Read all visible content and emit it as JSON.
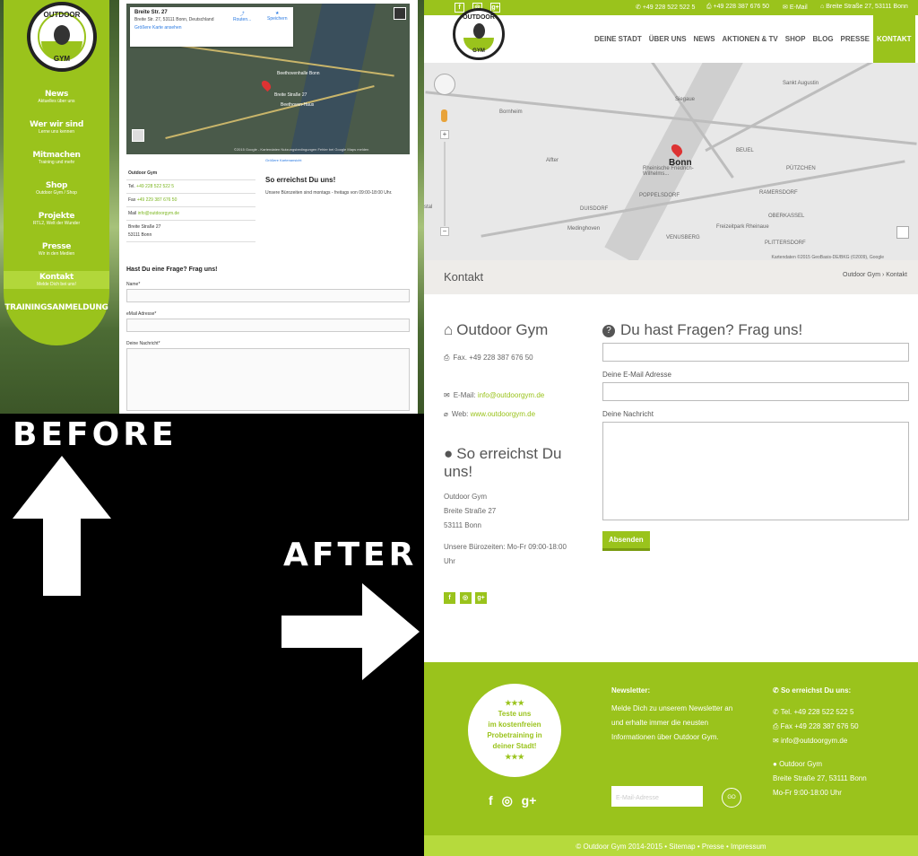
{
  "labels": {
    "before": "BEFORE",
    "after": "AFTER"
  },
  "before": {
    "logo": {
      "top": "OUTDOOR",
      "bottom": "GYM"
    },
    "nav": [
      {
        "main": "News",
        "sub": "Aktuelles über uns"
      },
      {
        "main": "Wer wir sind",
        "sub": "Lerne uns kennen"
      },
      {
        "main": "Mitmachen",
        "sub": "Training und mehr"
      },
      {
        "main": "Shop",
        "sub": "Outdoor Gym / Shop"
      },
      {
        "main": "Projekte",
        "sub": "RTL2, Welt der Wunder"
      },
      {
        "main": "Presse",
        "sub": "Wir in den Medien"
      },
      {
        "main": "Kontakt",
        "sub": "Melde Dich bei uns!"
      },
      {
        "main": "TRAININGSANMELDUNG",
        "sub": ""
      }
    ],
    "map_card": {
      "name": "Breite Str. 27",
      "address": "Breite Str. 27, 53111 Bonn, Deutschland",
      "link": "Größere Karte ansehen",
      "route": "Routen...",
      "save": "Speichern"
    },
    "map_labels": {
      "beethovenhalle": "Beethovenhalle Bonn",
      "street": "Breite Straße 27",
      "haus": "Beethoven-Haus",
      "footer": "©2015 Google - Kartendaten  Nutzungsbedingungen  Fehler bei Google Maps melden"
    },
    "info": {
      "name": "Outdoor Gym",
      "tel_label": "Tel.",
      "tel": "+49 228 522 522 5",
      "fax_label": "Fax",
      "fax": "+49 229 387 676 50",
      "mail_label": "Mail",
      "mail": "info@outdoorgym.de",
      "street": "Breite Straße 27",
      "city": "53111 Bonn"
    },
    "right": {
      "link": "Größere Kartenansicht",
      "heading": "So erreichst Du uns!",
      "text": "Unsere Bürozeiten sind montags - freitags von 09:00-18:00 Uhr."
    },
    "form": {
      "heading": "Hast Du eine Frage? Frag uns!",
      "name_label": "Name*",
      "email_label": "eMail Adresse*",
      "msg_label": "Deine Nachricht*"
    }
  },
  "after": {
    "topbar": {
      "tel": "+49 228 522 522 5",
      "fax": "+49 228 387 676 50",
      "email": "E-Mail",
      "address": "Breite Straße 27, 53111 Bonn",
      "social": [
        "f",
        "◎",
        "g+"
      ]
    },
    "logo": {
      "top": "OUTDOOR",
      "bottom": "GYM"
    },
    "nav": [
      "DEINE STADT",
      "ÜBER UNS",
      "NEWS",
      "AKTIONEN & TV",
      "SHOP",
      "BLOG",
      "PRESSE",
      "KONTAKT"
    ],
    "map_labels": {
      "city": "Bonn",
      "bornheim": "Bornheim",
      "alfter": "Alfter",
      "siegaue": "Siegaue",
      "augustin": "Sankt Augustin",
      "beuel": "BEUEL",
      "poppelsdorf": "POPPELSDORF",
      "duisdorf": "DUISDORF",
      "medinghoven": "Medinghoven",
      "venusberg": "VENUSBERG",
      "rheinaue": "Freizeitpark Rheinaue",
      "ramersdorf": "RAMERSDORF",
      "oberkassel": "OBERKASSEL",
      "pützchen": "PÜTZCHEN",
      "rheinische": "Rheinische Friedrich-Wilhelms...",
      "ittsdorf": "PLITTERSDORF",
      "stal": "stal",
      "scale": "Kartendaten ©2015 GeoBasis-DE/BKG (©2009), Google"
    },
    "crumb": {
      "title": "Kontakt",
      "path": "Outdoor Gym  ›  Kontakt"
    },
    "left": {
      "heading": "Outdoor Gym",
      "fax": "Fax. +49 228 387 676 50",
      "email_label": "E-Mail:",
      "email": "info@outdoorgym.de",
      "web_label": "Web:",
      "web": "www.outdoorgym.de",
      "heading2": "So erreichst Du uns!",
      "addr": [
        "Outdoor Gym",
        "Breite Straße 27",
        "53111 Bonn"
      ],
      "hours": "Unsere Bürozeiten: Mo-Fr 09:00-18:00 Uhr",
      "social": [
        "f",
        "◎",
        "g+"
      ]
    },
    "form": {
      "heading": "Du hast Fragen? Frag uns!",
      "email_label": "Deine E-Mail Adresse",
      "msg_label": "Deine Nachricht",
      "submit": "Absenden"
    },
    "footer": {
      "promo": [
        "★★★",
        "Teste uns",
        "im kostenfreien",
        "Probetraining in",
        "deiner Stadt!",
        "★★★"
      ],
      "social": [
        "f",
        "◎",
        "g+"
      ],
      "news_heading": "Newsletter:",
      "news_text": "Melde Dich zu unserem Newsletter an und erhalte immer die neusten Informationen über Outdoor Gym.",
      "news_placeholder": "E-Mail-Adresse",
      "news_go": "GO",
      "contact_heading": "So erreichst Du uns:",
      "tel": "Tel. +49 228 522 522 5",
      "fax": "Fax +49 228 387 676 50",
      "mail": "info@outdoorgym.de",
      "name": "Outdoor Gym",
      "address": "Breite Straße 27, 53111 Bonn",
      "hours": "Mo-Fr  9:00-18:00 Uhr",
      "copyright": "© Outdoor Gym 2014-2015 • Sitemap • Presse • Impressum"
    }
  }
}
